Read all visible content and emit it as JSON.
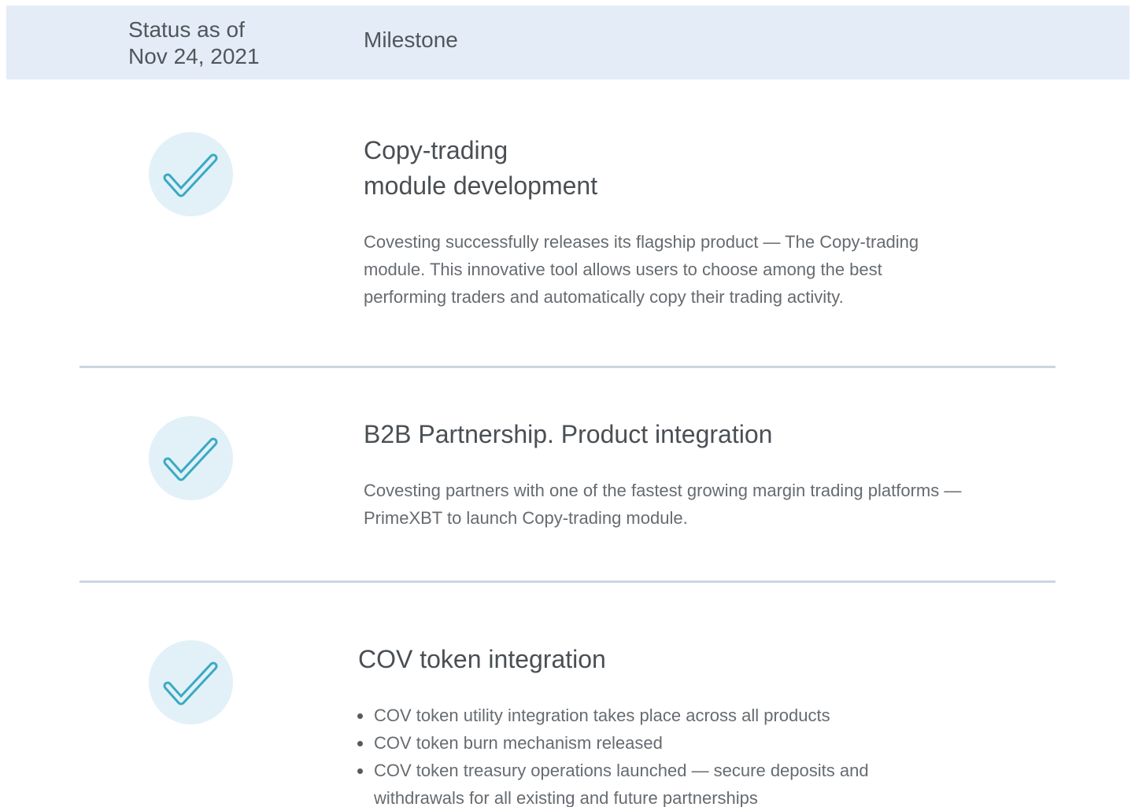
{
  "header": {
    "status_line1": "Status as of",
    "status_line2": "Nov 24, 2021",
    "milestone": "Milestone"
  },
  "colors": {
    "header_bg": "#e4ecf7",
    "check_circle": "#e1f1f7",
    "check_stroke": "#3aa9c4",
    "divider": "#cbd6df"
  },
  "milestones": [
    {
      "status_icon": "check-icon",
      "title_lines": [
        "Copy-trading",
        "module development"
      ],
      "desc_lines": [
        "Covesting successfully releases its flagship product — The Copy-trading",
        "module. This innovative tool allows users to choose among the best",
        "performing traders and automatically copy their trading activity."
      ]
    },
    {
      "status_icon": "check-icon",
      "title_lines": [
        "B2B Partnership. Product integration"
      ],
      "desc_lines": [
        "Covesting partners with one of the fastest growing margin trading platforms —",
        "PrimeXBT to launch Copy-trading module."
      ]
    },
    {
      "status_icon": "check-icon",
      "title_lines": [
        "COV token integration"
      ],
      "bullets": [
        [
          "COV token utility integration takes place across all products"
        ],
        [
          "COV token burn mechanism released"
        ],
        [
          "COV token treasury operations launched — secure deposits and",
          "withdrawals for all existing and future partnerships"
        ]
      ]
    }
  ]
}
